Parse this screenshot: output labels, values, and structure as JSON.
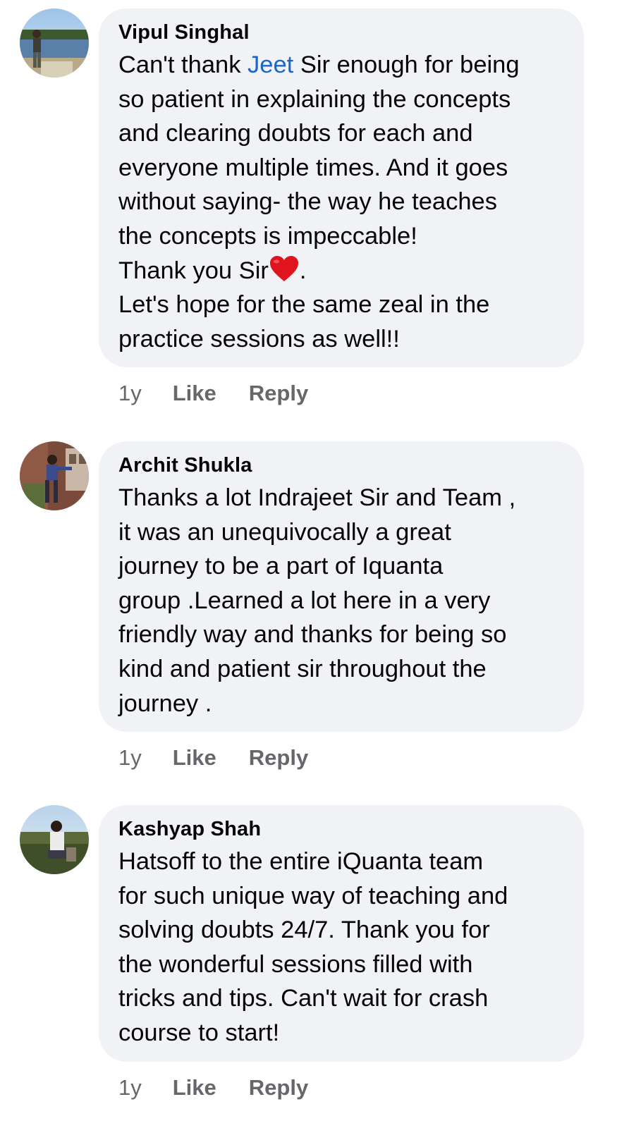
{
  "comments": [
    {
      "author": "Vipul Singhal",
      "lines": [
        [
          "Can't thank ",
          "Jeet",
          " Sir enough for being"
        ],
        "so patient in explaining the concepts",
        "and clearing doubts for each and",
        "everyone multiple times. And it goes",
        "without saying- the way he teaches",
        "the concepts is impeccable!",
        [
          "Thank you Sir",
          "heart-emoji",
          "."
        ],
        "Let's hope for the same zeal in the",
        "practice sessions as well!!"
      ],
      "line_texts": {
        "l1a": "Can't thank ",
        "mention": "Jeet",
        "l1b": " Sir enough for being",
        "l2": "so patient in explaining the concepts",
        "l3": "and clearing doubts for each and",
        "l4": "everyone multiple times. And it goes",
        "l5": "without saying- the way he teaches",
        "l6": "the concepts is impeccable!",
        "l7a": "Thank you Sir",
        "l7b": ".",
        "l8": "Let's hope for the same zeal in the",
        "l9": "practice sessions as well!!"
      },
      "time": "1y",
      "like_label": "Like",
      "reply_label": "Reply"
    },
    {
      "author": "Archit Shukla",
      "line_texts": {
        "l1": "Thanks a lot Indrajeet Sir and Team ,",
        "l2": "it was an unequivocally a great",
        "l3": "journey to be a part of Iquanta",
        "l4": "group .Learned a lot here in a very",
        "l5": "friendly way  and thanks for being so",
        "l6": "kind and patient sir throughout the",
        "l7": "journey ."
      },
      "time": "1y",
      "like_label": "Like",
      "reply_label": "Reply"
    },
    {
      "author": "Kashyap Shah",
      "line_texts": {
        "l1": "Hatsoff to the entire iQuanta team",
        "l2": "for such unique way of teaching and",
        "l3": "solving doubts 24/7. Thank you for",
        "l4": "the wonderful sessions filled with",
        "l5": "tricks and tips. Can't wait for crash",
        "l6": "course to start!"
      },
      "time": "1y",
      "like_label": "Like",
      "reply_label": "Reply"
    }
  ],
  "colors": {
    "bubble_bg": "#f0f2f5",
    "mention": "#1b66c9",
    "meta_text": "#65676b",
    "heart": "#e0141e"
  },
  "icons": {
    "heart": "heart-emoji",
    "avatar_1": "avatar-photo",
    "avatar_2": "avatar-photo",
    "avatar_3": "avatar-photo"
  }
}
